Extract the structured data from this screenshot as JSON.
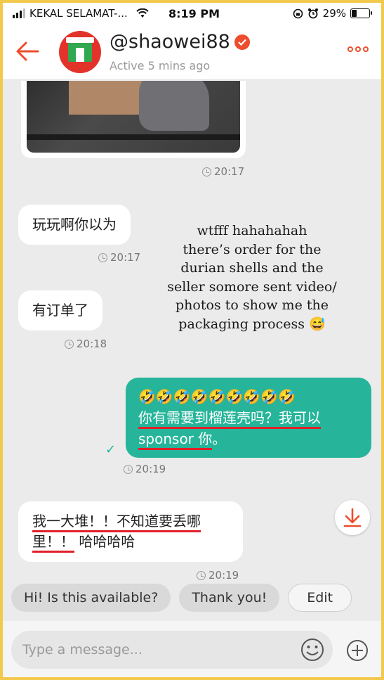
{
  "status_bar": {
    "carrier": "KEKAL SELAMAT-...",
    "time": "8:19 PM",
    "battery_text": "29%",
    "battery_level": 0.29
  },
  "header": {
    "username": "@shaowei88",
    "active_status": "Active 5 mins ago"
  },
  "messages": [
    {
      "type": "image",
      "direction": "incoming",
      "time": "20:17"
    },
    {
      "type": "text",
      "direction": "incoming",
      "text": "玩玩啊你以为",
      "time": "20:17"
    },
    {
      "type": "text",
      "direction": "incoming",
      "text": "有订单了",
      "time": "20:18"
    },
    {
      "type": "text",
      "direction": "outgoing",
      "emojis": "🤣🤣🤣🤣🤣🤣🤣🤣🤣",
      "line1": "你有需要到榴莲壳吗？我可以",
      "line2_a": "sponsor 你",
      "line2_b": "。",
      "time": "20:19"
    },
    {
      "type": "text",
      "direction": "incoming",
      "line1": "我一大堆！！不知道要丢哪",
      "line2_a": "里！！",
      "line2_b": "哈哈哈哈",
      "time": "20:19"
    }
  ],
  "caption": {
    "lines": [
      "wtfff hahahahah",
      "there’s order for the",
      "durian shells and the",
      "seller somore sent video/",
      "photos to show me the",
      "packaging process 😅"
    ]
  },
  "quick_replies": [
    "Hi! Is this available?",
    "Thank you!",
    "Edit"
  ],
  "input": {
    "placeholder": "Type a message..."
  },
  "colors": {
    "accent": "#ee4d2d",
    "outgoing_bubble": "#26b59a",
    "underline": "#e0202a",
    "frame": "#f2c94c"
  }
}
